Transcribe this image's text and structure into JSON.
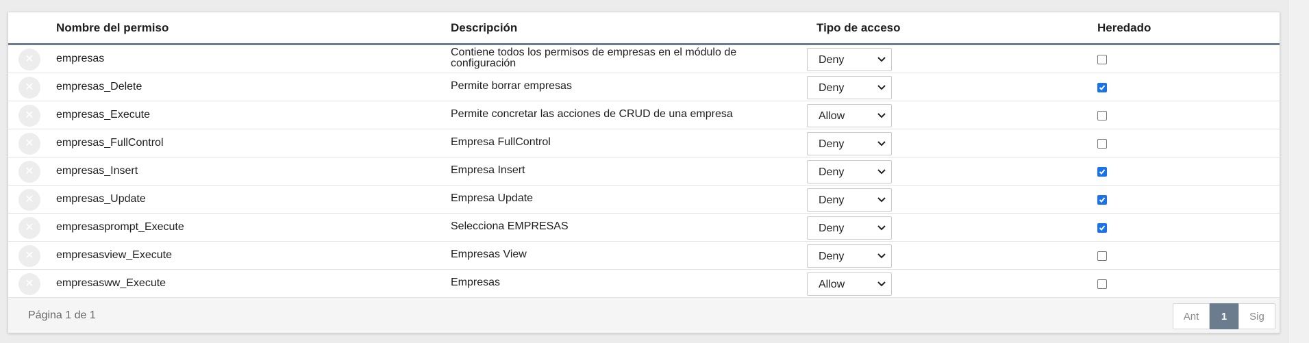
{
  "table": {
    "headers": {
      "name": "Nombre del permiso",
      "description": "Descripción",
      "access_type": "Tipo de acceso",
      "inherited": "Heredado"
    },
    "rows": [
      {
        "name": "empresas",
        "description": "Contiene todos los permisos de empresas en el módulo de configuración",
        "access": "Deny",
        "inherited": false
      },
      {
        "name": "empresas_Delete",
        "description": "Permite borrar empresas",
        "access": "Deny",
        "inherited": true
      },
      {
        "name": "empresas_Execute",
        "description": "Permite concretar las acciones de CRUD de una empresa",
        "access": "Allow",
        "inherited": false
      },
      {
        "name": "empresas_FullControl",
        "description": "Empresa FullControl",
        "access": "Deny",
        "inherited": false
      },
      {
        "name": "empresas_Insert",
        "description": "Empresa Insert",
        "access": "Deny",
        "inherited": true
      },
      {
        "name": "empresas_Update",
        "description": "Empresa Update",
        "access": "Deny",
        "inherited": true
      },
      {
        "name": "empresasprompt_Execute",
        "description": "Selecciona EMPRESAS",
        "access": "Deny",
        "inherited": true
      },
      {
        "name": "empresasview_Execute",
        "description": "Empresas View",
        "access": "Deny",
        "inherited": false
      },
      {
        "name": "empresasww_Execute",
        "description": "Empresas",
        "access": "Allow",
        "inherited": false
      }
    ]
  },
  "footer": {
    "page_info": "Página 1 de 1",
    "prev_label": "Ant",
    "current_page": "1",
    "next_label": "Sig"
  },
  "colors": {
    "accent": "#6b7c8f",
    "checkbox_checked": "#1a73e8"
  },
  "icons": {
    "delete": "close-icon",
    "dropdown": "chevron-down-icon"
  }
}
